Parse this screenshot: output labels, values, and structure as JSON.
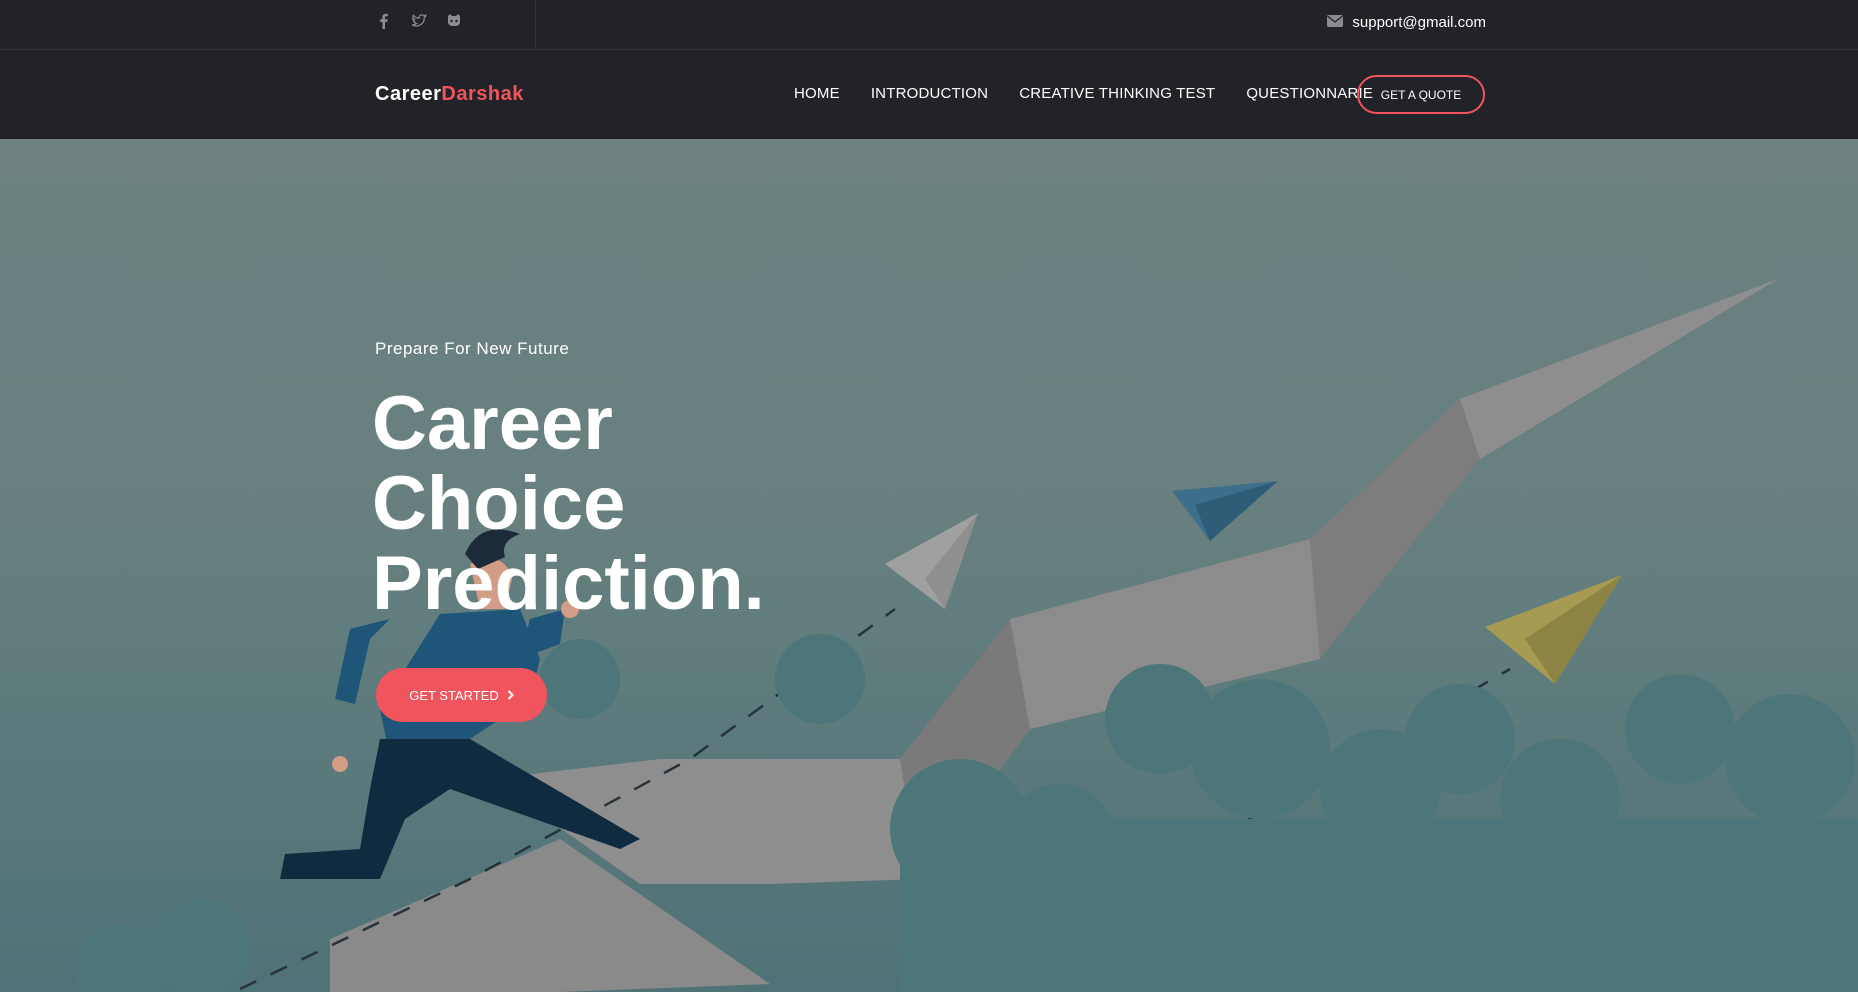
{
  "topbar": {
    "social_icons": [
      "facebook-icon",
      "twitter-icon",
      "github-icon"
    ],
    "email": "support@gmail.com"
  },
  "navbar": {
    "brand_part1": "Career",
    "brand_part2": "Darshak",
    "links": [
      "HOME",
      "INTRODUCTION",
      "CREATIVE THINKING TEST",
      "QUESTIONNARIE"
    ],
    "quote_button": "GET A QUOTE"
  },
  "hero": {
    "pretitle": "Prepare For New Future",
    "title_lines": [
      "Career",
      "Choice",
      "Prediction."
    ],
    "cta": "GET STARTED"
  },
  "colors": {
    "accent": "#f0545d",
    "dark": "#222329"
  }
}
